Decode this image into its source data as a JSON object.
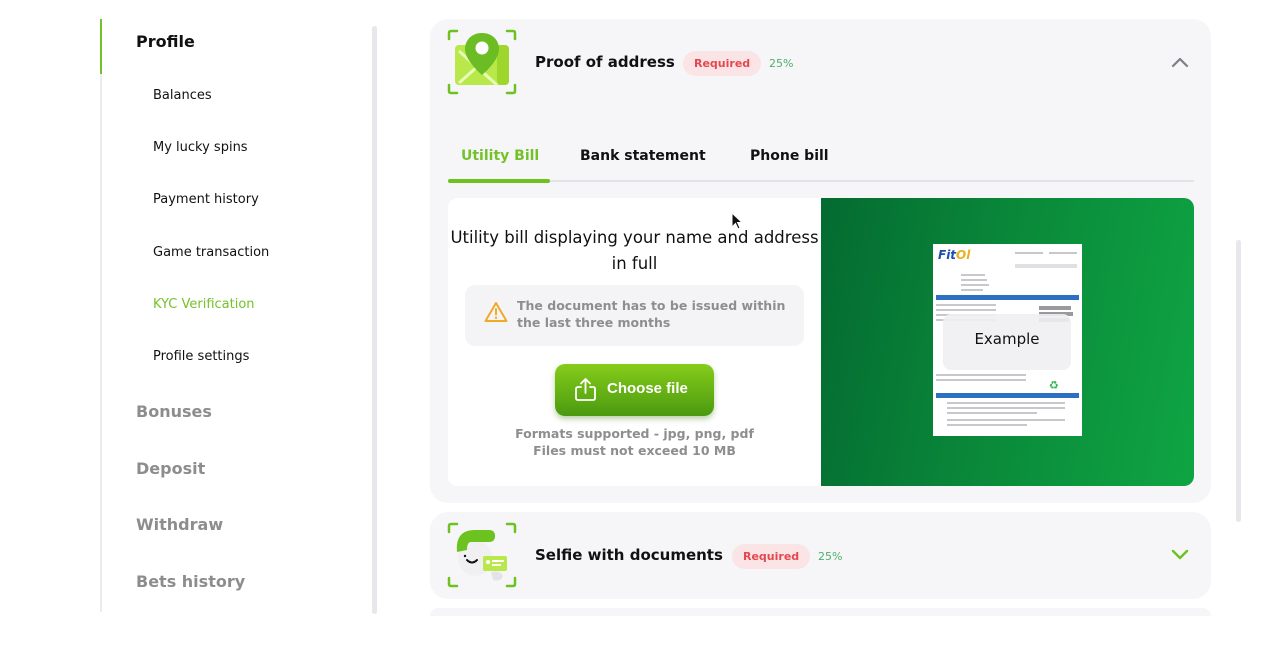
{
  "sidebar": {
    "sections": [
      {
        "label": "Profile",
        "active": true
      },
      {
        "label": "Bonuses"
      },
      {
        "label": "Deposit"
      },
      {
        "label": "Withdraw"
      },
      {
        "label": "Bets history"
      }
    ],
    "profile_items": [
      {
        "label": "Balances"
      },
      {
        "label": "My lucky spins"
      },
      {
        "label": "Payment history"
      },
      {
        "label": "Game transaction"
      },
      {
        "label": "KYC Verification",
        "active": true
      },
      {
        "label": "Profile settings"
      }
    ]
  },
  "cards": [
    {
      "title": "Proof of address",
      "icon": "map-pin-icon",
      "badge": "Required",
      "progress": "25%",
      "expanded": true,
      "tabs": [
        {
          "label": "Utility Bill",
          "active": true
        },
        {
          "label": "Bank statement"
        },
        {
          "label": "Phone bill"
        }
      ],
      "content": {
        "title": "Utility bill displaying your name and address in full",
        "warning": "The document has to be issued within the last three months",
        "button_label": "Choose file",
        "formats": "Formats supported - jpg, png, pdf",
        "size_limit": "Files must not exceed 10 MB",
        "example_label": "Example",
        "example_logo_a": "Fit",
        "example_logo_b": "Ol"
      }
    },
    {
      "title": "Selfie with documents",
      "icon": "selfie-id-icon",
      "badge": "Required",
      "progress": "25%",
      "expanded": false
    }
  ],
  "colors": {
    "accent": "#74c22a",
    "badge_bg": "#fbe4e6",
    "badge_text": "#e5474f",
    "progress_text": "#4caf6a",
    "card_bg": "#f6f6f8"
  }
}
